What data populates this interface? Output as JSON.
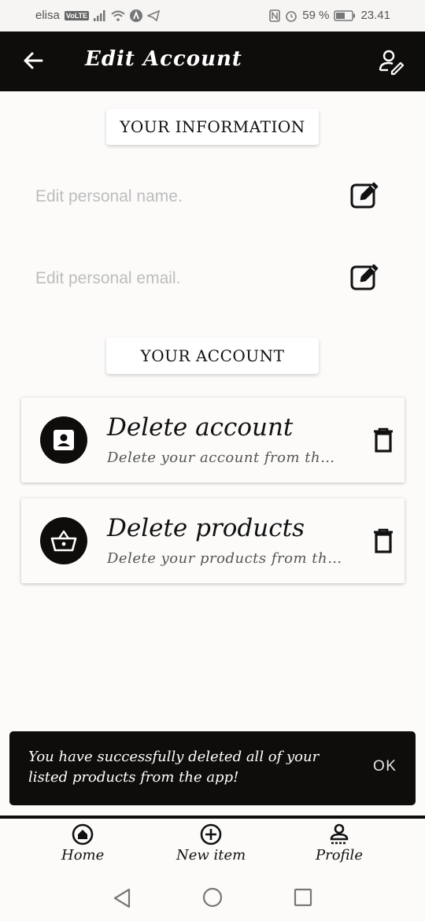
{
  "status_bar": {
    "carrier": "elisa",
    "volte": "VoLTE",
    "battery": "59 %",
    "time": "23.41"
  },
  "app_bar": {
    "title": "Edit Account"
  },
  "sections": {
    "info_title": "YOUR INFORMATION",
    "account_title": "YOUR ACCOUNT"
  },
  "fields": {
    "name_placeholder": "Edit personal name.",
    "email_placeholder": "Edit personal email."
  },
  "cards": [
    {
      "title": "Delete account",
      "subtitle": "Delete your account from the app"
    },
    {
      "title": "Delete products",
      "subtitle": "Delete your products from the app"
    }
  ],
  "snackbar": {
    "message": "You have successfully deleted all of your listed products from the app!",
    "action": "OK"
  },
  "bottom_nav": {
    "items": [
      {
        "label": "Home",
        "icon": "home-icon"
      },
      {
        "label": "New item",
        "icon": "add-circle-icon"
      },
      {
        "label": "Profile",
        "icon": "person-icon"
      }
    ]
  },
  "colors": {
    "primary_dark": "#0f0d0b",
    "background": "#fcfbfa",
    "placeholder": "#bdbdbd"
  }
}
